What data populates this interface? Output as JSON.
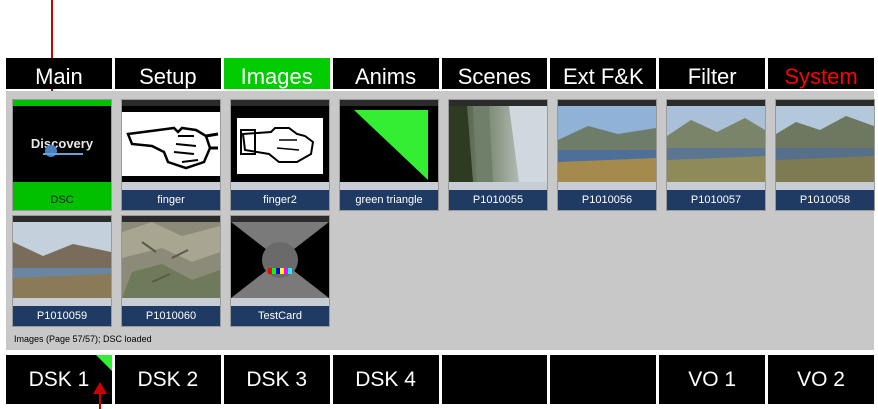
{
  "tabs": [
    {
      "label": "Main"
    },
    {
      "label": "Setup"
    },
    {
      "label": "Images"
    },
    {
      "label": "Anims"
    },
    {
      "label": "Scenes"
    },
    {
      "label": "Ext F&K"
    },
    {
      "label": "Filter"
    },
    {
      "label": "System"
    }
  ],
  "images": [
    {
      "label": "DSC",
      "logo": "Discovery"
    },
    {
      "label": "finger"
    },
    {
      "label": "finger2"
    },
    {
      "label": "green triangle"
    },
    {
      "label": "P1010055"
    },
    {
      "label": "P1010056"
    },
    {
      "label": "P1010057"
    },
    {
      "label": "P1010058"
    },
    {
      "label": "P1010059"
    },
    {
      "label": "P1010060"
    },
    {
      "label": "TestCard"
    }
  ],
  "status_text": "Images (Page 57/57); DSC loaded",
  "dsk_buttons": [
    {
      "label": "DSK 1"
    },
    {
      "label": "DSK 2"
    },
    {
      "label": "DSK 3"
    },
    {
      "label": "DSK 4"
    },
    {
      "label": ""
    },
    {
      "label": ""
    },
    {
      "label": "VO 1"
    },
    {
      "label": "VO 2"
    }
  ],
  "colors": {
    "active": "#00cc00",
    "system": "#ff0000",
    "label_bar": "#1f3b64",
    "arrow": "#cc0000"
  }
}
